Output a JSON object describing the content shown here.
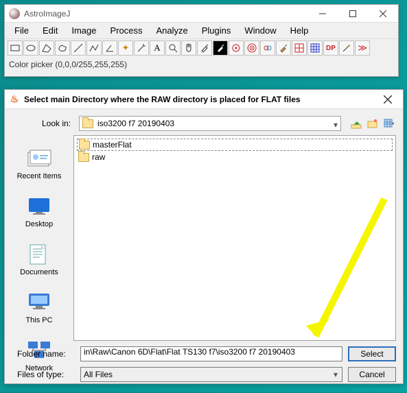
{
  "main_window": {
    "title": "AstroImageJ",
    "menu": [
      "File",
      "Edit",
      "Image",
      "Process",
      "Analyze",
      "Plugins",
      "Window",
      "Help"
    ],
    "toolbar_icons": [
      "rectangle-select",
      "oval-select",
      "polygon-select",
      "freehand-select",
      "line-tool",
      "segmented-line",
      "angle-tool",
      "multi-point",
      "wand-tool",
      "text-tool",
      "magnifier",
      "hand-scroll",
      "dropper",
      "filled-dropper",
      "target",
      "concentric-target",
      "double-target",
      "brush",
      "grid4",
      "grid5",
      "dp-tool",
      "sparkle",
      "more"
    ],
    "status": "Color picker (0,0,0/255,255,255)"
  },
  "dialog": {
    "title": "Select main Directory where the RAW directory is placed for FLAT files",
    "look_in_label": "Look in:",
    "look_in_value": "iso3200 f7 20190403",
    "nav_icons": [
      "up-one-level",
      "new-folder",
      "view-options"
    ],
    "places": [
      {
        "key": "recent",
        "label": "Recent Items"
      },
      {
        "key": "desktop",
        "label": "Desktop"
      },
      {
        "key": "documents",
        "label": "Documents"
      },
      {
        "key": "thispc",
        "label": "This PC"
      },
      {
        "key": "network",
        "label": "Network"
      }
    ],
    "files": [
      {
        "name": "masterFlat",
        "selected": true
      },
      {
        "name": "raw",
        "selected": false
      }
    ],
    "folder_name_label": "Folder name:",
    "folder_name_value": "in\\Raw\\Canon 6D\\Flat\\Flat TS130 f7\\iso3200 f7 20190403",
    "files_type_label": "Files of type:",
    "files_type_value": "All Files",
    "select_btn": "Select",
    "cancel_btn": "Cancel"
  }
}
